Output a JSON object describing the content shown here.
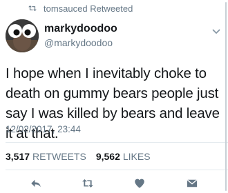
{
  "retweet_banner": {
    "text": "tomsauced Retweeted",
    "icon": "retweet-icon"
  },
  "author": {
    "display_name": "markydoodoo",
    "handle": "@markydoodoo",
    "avatar": "avatar-icon"
  },
  "tweet": {
    "text": "I hope when I inevitably choke to death on gummy bears people just say I was killed by bears and leave it at that.",
    "timestamp": "12/02/2017, 23:44"
  },
  "stats": {
    "retweets_count": "3,517",
    "retweets_label": "RETWEETS",
    "likes_count": "9,562",
    "likes_label": "LIKES"
  },
  "actions": [
    {
      "name": "reply-icon"
    },
    {
      "name": "retweet-icon"
    },
    {
      "name": "like-icon"
    },
    {
      "name": "message-icon"
    }
  ],
  "colors": {
    "text": "#14171a",
    "secondary": "#657786",
    "divider": "#e1e8ed",
    "icon": "#657786"
  }
}
